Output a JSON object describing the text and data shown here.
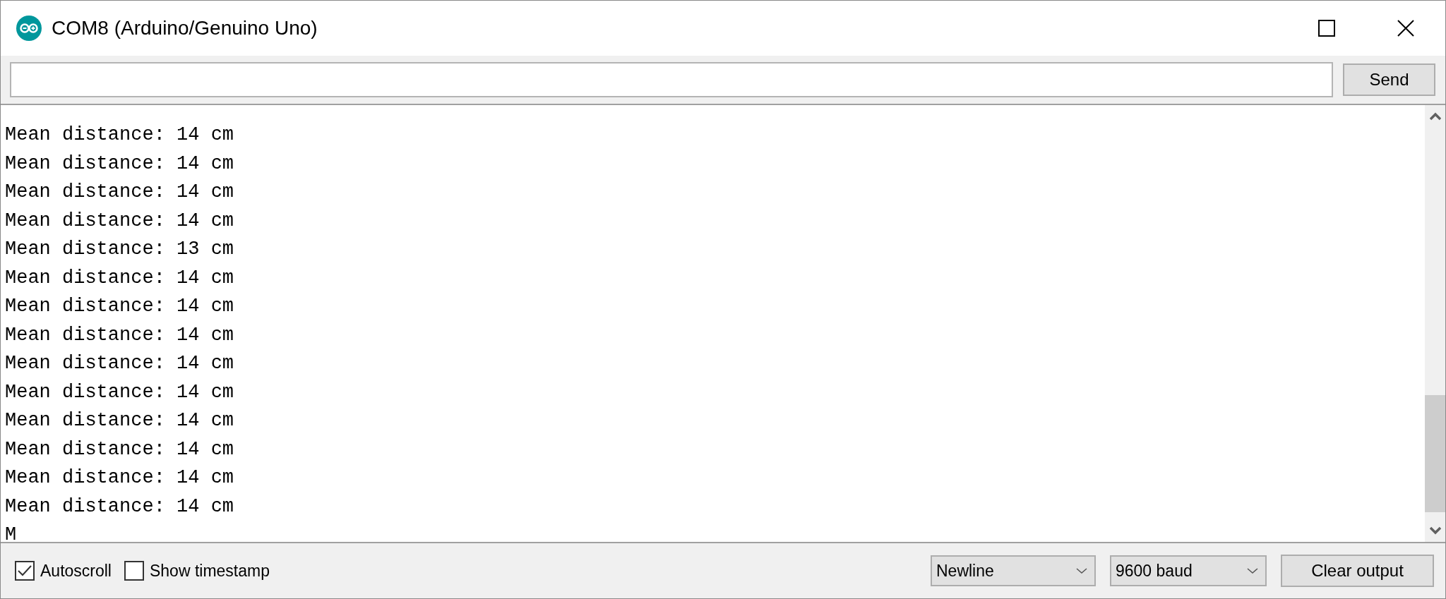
{
  "window": {
    "title": "COM8 (Arduino/Genuino Uno)"
  },
  "send_button": "Send",
  "output_lines": [
    "Mean distance: 14 cm",
    "Mean distance: 14 cm",
    "Mean distance: 14 cm",
    "Mean distance: 14 cm",
    "Mean distance: 13 cm",
    "Mean distance: 14 cm",
    "Mean distance: 14 cm",
    "Mean distance: 14 cm",
    "Mean distance: 14 cm",
    "Mean distance: 14 cm",
    "Mean distance: 14 cm",
    "Mean distance: 14 cm",
    "Mean distance: 14 cm",
    "Mean distance: 14 cm",
    "M"
  ],
  "options": [
    {
      "label": "Autoscroll",
      "checked": true
    },
    {
      "label": "Show timestamp",
      "checked": false
    }
  ],
  "line_ending": "Newline",
  "baud_rate": "9600 baud",
  "clear_button": "Clear output"
}
